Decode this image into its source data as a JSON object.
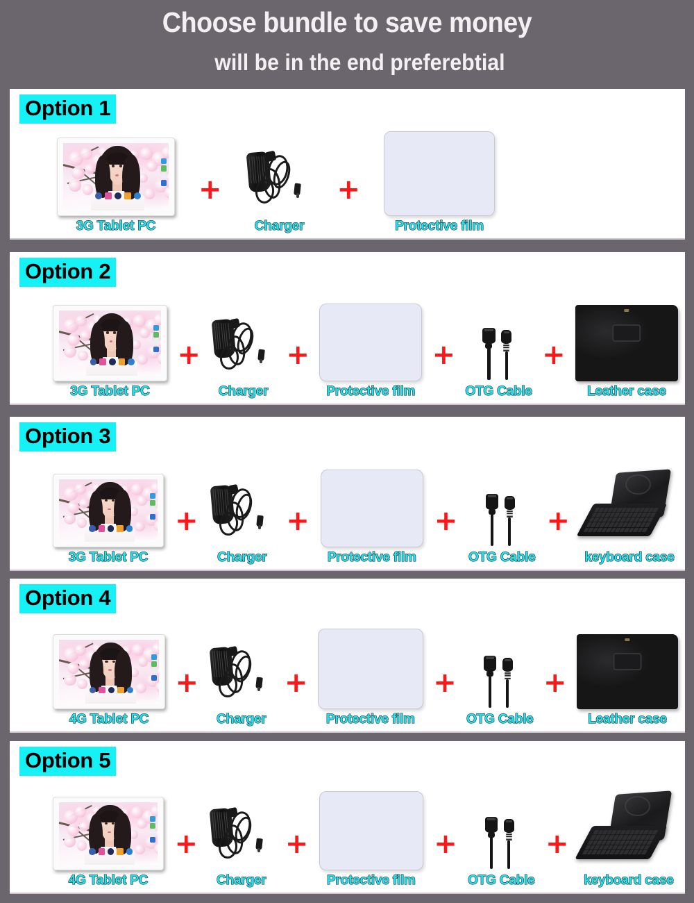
{
  "header": {
    "line1": "Choose bundle to save money",
    "line2": "will be in the end preferebtial"
  },
  "colors": {
    "background": "#6b666e",
    "panel": "#ffffff",
    "badge_bg": "#16f1f5",
    "badge_text": "#000000",
    "label_text": "#1fe3f0",
    "plus_sign": "#fc1818",
    "header_text": "#f4eff2",
    "film_fill": "#e8e9f6"
  },
  "plus_symbol": "+",
  "options": [
    {
      "badge": "Option 1",
      "items": [
        {
          "label": "3G Tablet PC",
          "icon": "tablet-icon"
        },
        {
          "label": "Charger",
          "icon": "charger-icon"
        },
        {
          "label": "Protective film",
          "icon": "protective-film-icon"
        }
      ]
    },
    {
      "badge": "Option 2",
      "items": [
        {
          "label": "3G Tablet PC",
          "icon": "tablet-icon"
        },
        {
          "label": "Charger",
          "icon": "charger-icon"
        },
        {
          "label": "Protective film",
          "icon": "protective-film-icon"
        },
        {
          "label": "OTG Cable",
          "icon": "otg-cable-icon"
        },
        {
          "label": "Leather case",
          "icon": "leather-case-icon"
        }
      ]
    },
    {
      "badge": "Option 3",
      "items": [
        {
          "label": "3G Tablet PC",
          "icon": "tablet-icon"
        },
        {
          "label": "Charger",
          "icon": "charger-icon"
        },
        {
          "label": "Protective film",
          "icon": "protective-film-icon"
        },
        {
          "label": "OTG Cable",
          "icon": "otg-cable-icon"
        },
        {
          "label": "keyboard case",
          "icon": "keyboard-case-icon"
        }
      ]
    },
    {
      "badge": "Option 4",
      "items": [
        {
          "label": "4G Tablet PC",
          "icon": "tablet-icon"
        },
        {
          "label": "Charger",
          "icon": "charger-icon"
        },
        {
          "label": "Protective film",
          "icon": "protective-film-icon"
        },
        {
          "label": "OTG Cable",
          "icon": "otg-cable-icon"
        },
        {
          "label": "Leather case",
          "icon": "leather-case-icon"
        }
      ]
    },
    {
      "badge": "Option 5",
      "items": [
        {
          "label": "4G Tablet PC",
          "icon": "tablet-icon"
        },
        {
          "label": "Charger",
          "icon": "charger-icon"
        },
        {
          "label": "Protective film",
          "icon": "protective-film-icon"
        },
        {
          "label": "OTG Cable",
          "icon": "otg-cable-icon"
        },
        {
          "label": "keyboard case",
          "icon": "keyboard-case-icon"
        }
      ]
    }
  ]
}
